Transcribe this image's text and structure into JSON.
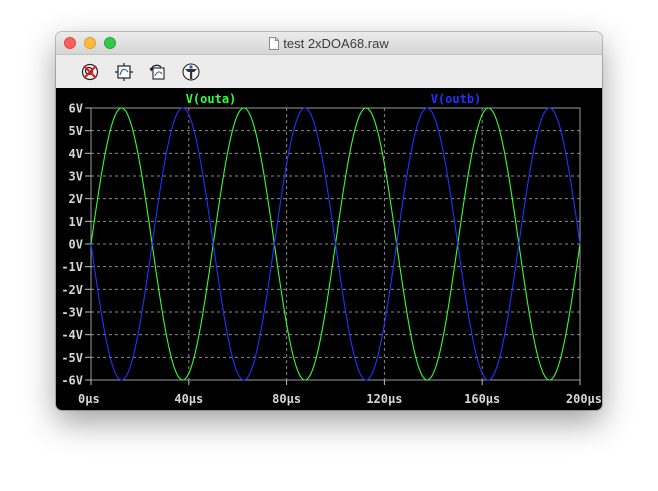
{
  "window": {
    "title": "test 2xDOA68.raw",
    "controls": [
      "close",
      "minimize",
      "zoom"
    ]
  },
  "toolbar": {
    "tools": [
      {
        "icon": "zoom-cancel-icon",
        "label": ""
      },
      {
        "icon": "autorange-icon",
        "label": ""
      },
      {
        "icon": "undo-icon",
        "label": ""
      },
      {
        "icon": "probe-icon",
        "label": ""
      }
    ]
  },
  "colors": {
    "background": "#000000",
    "grid": "#8a8a8a",
    "outa": "#33ff33",
    "outb": "#2233ff"
  },
  "chart_data": {
    "type": "line",
    "title": "",
    "xlabel": "",
    "ylabel": "",
    "xlim": [
      0,
      200
    ],
    "ylim": [
      -6,
      6
    ],
    "grid": true,
    "x_ticks": [
      "0µs",
      "40µs",
      "80µs",
      "120µs",
      "160µs",
      "200µs"
    ],
    "y_ticks": [
      "6V",
      "5V",
      "4V",
      "3V",
      "2V",
      "1V",
      "0V",
      "-1V",
      "-2V",
      "-3V",
      "-4V",
      "-5V",
      "-6V"
    ],
    "x_unit": "µs",
    "y_unit": "V",
    "series": [
      {
        "name": "V(outa)",
        "color": "#33ff33",
        "shape": "sine",
        "amplitude": 6,
        "period": 50,
        "phase": 0,
        "x": [
          0,
          12.5,
          25,
          37.5,
          50,
          62.5,
          75,
          87.5,
          100,
          112.5,
          125,
          137.5,
          150,
          162.5,
          175,
          187.5,
          200
        ],
        "y": [
          0,
          6,
          0,
          -6,
          0,
          6,
          0,
          -6,
          0,
          6,
          0,
          -6,
          0,
          6,
          0,
          -6,
          0
        ]
      },
      {
        "name": "V(outb)",
        "color": "#2233ff",
        "shape": "sine",
        "amplitude": 6,
        "period": 50,
        "phase": 180,
        "x": [
          0,
          12.5,
          25,
          37.5,
          50,
          62.5,
          75,
          87.5,
          100,
          112.5,
          125,
          137.5,
          150,
          162.5,
          175,
          187.5,
          200
        ],
        "y": [
          0,
          -6,
          0,
          6,
          0,
          -6,
          0,
          6,
          0,
          -6,
          0,
          6,
          0,
          -6,
          0,
          6,
          0
        ]
      }
    ]
  }
}
